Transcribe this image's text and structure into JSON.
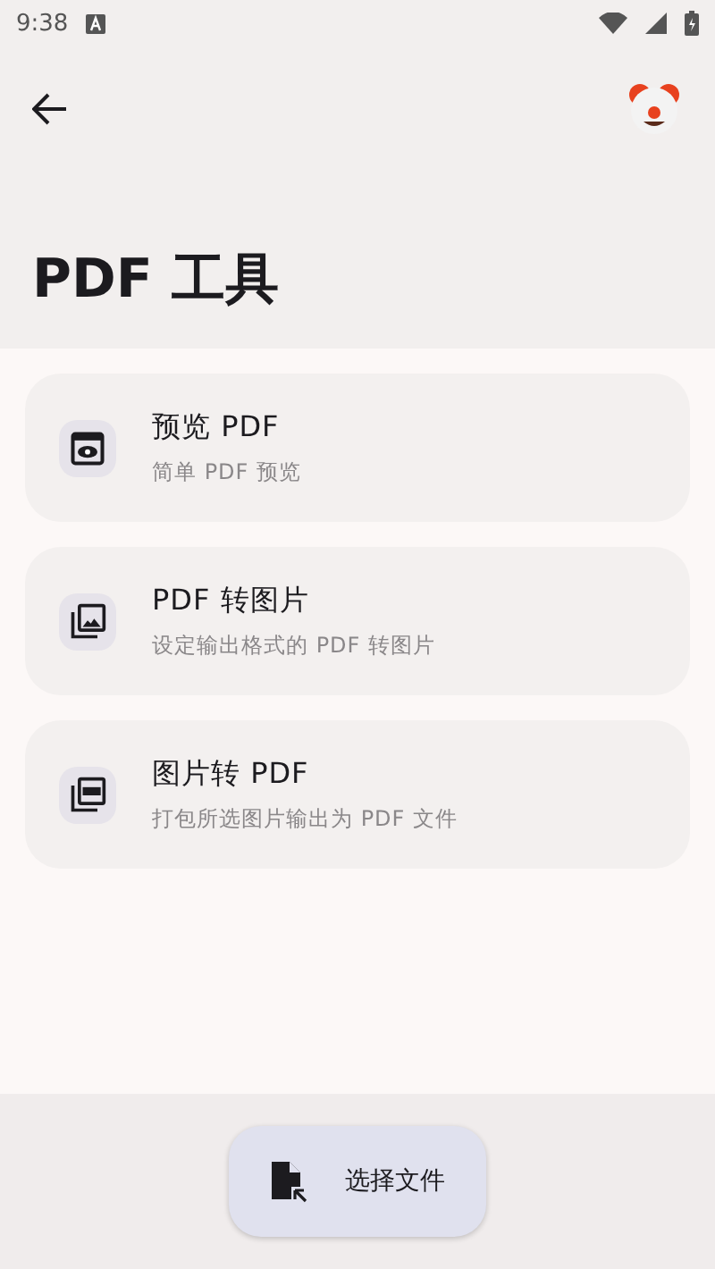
{
  "status_bar": {
    "time": "9:38"
  },
  "app_bar": {
    "title": "PDF 工具"
  },
  "tools": [
    {
      "title": "预览 PDF",
      "subtitle": "简单 PDF 预览"
    },
    {
      "title": "PDF 转图片",
      "subtitle": "设定输出格式的 PDF 转图片"
    },
    {
      "title": "图片转 PDF",
      "subtitle": "打包所选图片输出为 PDF 文件"
    }
  ],
  "action_button": {
    "label": "选择文件"
  }
}
